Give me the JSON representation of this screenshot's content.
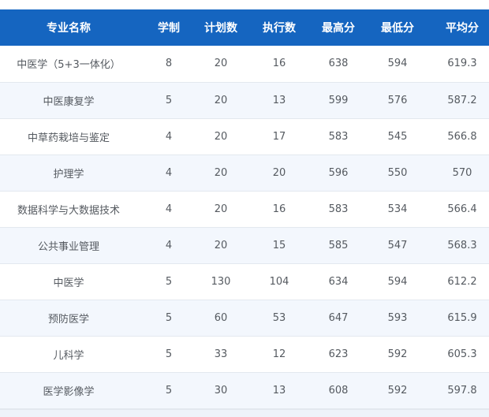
{
  "table": {
    "headers": [
      "专业名称",
      "学制",
      "计划数",
      "执行数",
      "最高分",
      "最低分",
      "平均分"
    ],
    "rows": [
      [
        "中医学（5+3一体化）",
        "8",
        "20",
        "16",
        "638",
        "594",
        "619.3"
      ],
      [
        "中医康复学",
        "5",
        "20",
        "13",
        "599",
        "576",
        "587.2"
      ],
      [
        "中草药栽培与鉴定",
        "4",
        "20",
        "17",
        "583",
        "545",
        "566.8"
      ],
      [
        "护理学",
        "4",
        "20",
        "20",
        "596",
        "550",
        "570"
      ],
      [
        "数据科学与大数据技术",
        "4",
        "20",
        "16",
        "583",
        "534",
        "566.4"
      ],
      [
        "公共事业管理",
        "4",
        "20",
        "15",
        "585",
        "547",
        "568.3"
      ],
      [
        "中医学",
        "5",
        "130",
        "104",
        "634",
        "594",
        "612.2"
      ],
      [
        "预防医学",
        "5",
        "60",
        "53",
        "647",
        "593",
        "615.9"
      ],
      [
        "儿科学",
        "5",
        "33",
        "12",
        "623",
        "592",
        "605.3"
      ],
      [
        "医学影像学",
        "5",
        "30",
        "13",
        "608",
        "592",
        "597.8"
      ]
    ]
  },
  "colors": {
    "header_bg": "#1565c0",
    "header_text": "#ffffff",
    "row_alt_bg": "#f3f7fd",
    "cell_text": "#555a60"
  }
}
